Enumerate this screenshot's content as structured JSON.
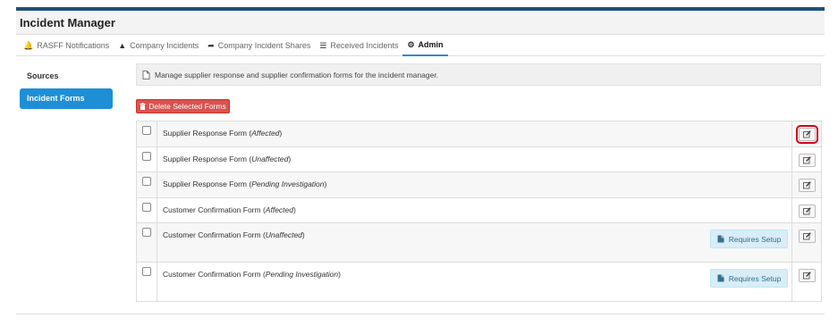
{
  "app": {
    "title": "Incident Manager"
  },
  "tabs": [
    {
      "label": "RASFF Notifications",
      "icon": "bell-icon",
      "glyph": "🔔"
    },
    {
      "label": "Company Incidents",
      "icon": "warning-icon",
      "glyph": "▲"
    },
    {
      "label": "Company Incident Shares",
      "icon": "share-icon",
      "glyph": "➦"
    },
    {
      "label": "Received Incidents",
      "icon": "list-icon",
      "glyph": "☰"
    },
    {
      "label": "Admin",
      "icon": "gear-icon",
      "glyph": "⚙",
      "active": true
    }
  ],
  "sidebar": {
    "items": [
      {
        "label": "Sources"
      },
      {
        "label": "Incident Forms",
        "active": true
      }
    ]
  },
  "info": {
    "text": "Manage supplier response and supplier confirmation forms for the incident manager.",
    "icon": "document-icon"
  },
  "actions": {
    "delete_label": "Delete Selected Forms"
  },
  "forms": [
    {
      "name": "Supplier Response Form",
      "variant": "Affected",
      "requires_setup": false,
      "highlighted_edit": true
    },
    {
      "name": "Supplier Response Form",
      "variant": "Unaffected",
      "requires_setup": false
    },
    {
      "name": "Supplier Response Form",
      "variant": "Pending Investigation",
      "requires_setup": false
    },
    {
      "name": "Customer Confirmation Form",
      "variant": "Affected",
      "requires_setup": false
    },
    {
      "name": "Customer Confirmation Form",
      "variant": "Unaffected",
      "requires_setup": true
    },
    {
      "name": "Customer Confirmation Form",
      "variant": "Pending Investigation",
      "requires_setup": true
    }
  ],
  "labels": {
    "requires_setup": "Requires Setup"
  },
  "colors": {
    "accent": "#1e8fd6",
    "danger": "#d9534f",
    "info_bg": "#d9edf7",
    "highlight": "#d0021b"
  }
}
